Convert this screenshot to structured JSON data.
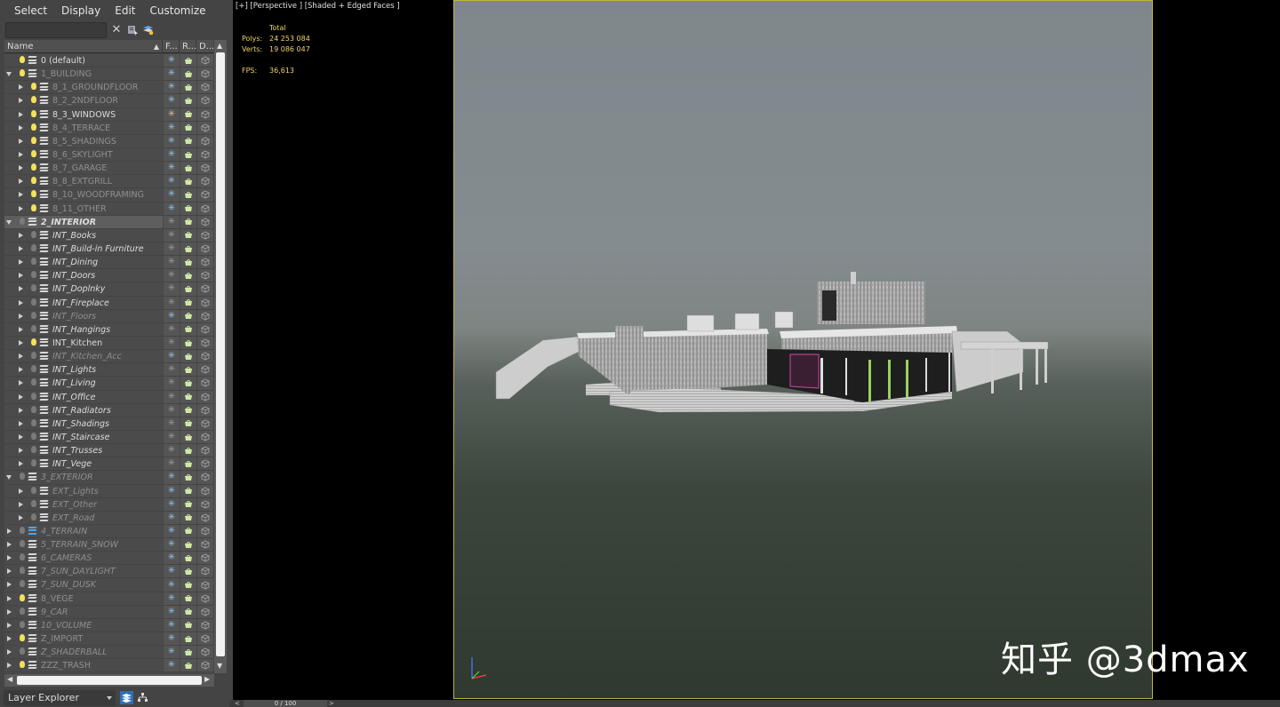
{
  "menu": [
    "Select",
    "Display",
    "Edit",
    "Customize"
  ],
  "columns": {
    "name": "Name",
    "freeze": "F...",
    "render": "R...",
    "display": "D..."
  },
  "layers": [
    {
      "name": "0 (default)",
      "indent": 0,
      "arrow": "none",
      "bulb": "on",
      "style": "normal",
      "freeze": "normal"
    },
    {
      "name": "1_BUILDING",
      "indent": 0,
      "arrow": "down",
      "bulb": "on",
      "style": "dim",
      "freeze": "normal"
    },
    {
      "name": "8_1_GROUNDFLOOR",
      "indent": 1,
      "arrow": "right",
      "bulb": "on",
      "style": "dim",
      "freeze": "normal"
    },
    {
      "name": "8_2_2NDFLOOR",
      "indent": 1,
      "arrow": "right",
      "bulb": "on",
      "style": "dim",
      "freeze": "normal"
    },
    {
      "name": "8_3_WINDOWS",
      "indent": 1,
      "arrow": "right",
      "bulb": "on",
      "style": "normal",
      "freeze": "hot"
    },
    {
      "name": "8_4_TERRACE",
      "indent": 1,
      "arrow": "right",
      "bulb": "on",
      "style": "dim",
      "freeze": "normal"
    },
    {
      "name": "8_5_SHADINGS",
      "indent": 1,
      "arrow": "right",
      "bulb": "on",
      "style": "dim",
      "freeze": "normal"
    },
    {
      "name": "8_6_SKYLIGHT",
      "indent": 1,
      "arrow": "right",
      "bulb": "on",
      "style": "dim",
      "freeze": "normal"
    },
    {
      "name": "8_7_GARAGE",
      "indent": 1,
      "arrow": "right",
      "bulb": "on",
      "style": "dim",
      "freeze": "normal"
    },
    {
      "name": "8_8_EXTGRILL",
      "indent": 1,
      "arrow": "right",
      "bulb": "on",
      "style": "dim",
      "freeze": "normal"
    },
    {
      "name": "8_10_WOODFRAMING",
      "indent": 1,
      "arrow": "right",
      "bulb": "on",
      "style": "dim",
      "freeze": "normal"
    },
    {
      "name": "8_11_OTHER",
      "indent": 1,
      "arrow": "right",
      "bulb": "on",
      "style": "dim",
      "freeze": "normal"
    },
    {
      "name": "2_INTERIOR",
      "indent": 0,
      "arrow": "down",
      "bulb": "off",
      "style": "bold-it",
      "freeze": "dim",
      "selected": true
    },
    {
      "name": "INT_Books",
      "indent": 1,
      "arrow": "right",
      "bulb": "off",
      "style": "it",
      "freeze": "dim"
    },
    {
      "name": "INT_Build-in Furniture",
      "indent": 1,
      "arrow": "right",
      "bulb": "off",
      "style": "it",
      "freeze": "dim"
    },
    {
      "name": "INT_Dining",
      "indent": 1,
      "arrow": "right",
      "bulb": "off",
      "style": "it",
      "freeze": "dim"
    },
    {
      "name": "INT_Doors",
      "indent": 1,
      "arrow": "right",
      "bulb": "off",
      "style": "it",
      "freeze": "dim"
    },
    {
      "name": "INT_Doplnky",
      "indent": 1,
      "arrow": "right",
      "bulb": "off",
      "style": "it",
      "freeze": "dim"
    },
    {
      "name": "INT_Fireplace",
      "indent": 1,
      "arrow": "right",
      "bulb": "off",
      "style": "it",
      "freeze": "dim"
    },
    {
      "name": "INT_Floors",
      "indent": 1,
      "arrow": "right",
      "bulb": "off",
      "style": "dim-it",
      "freeze": "normal"
    },
    {
      "name": "INT_Hangings",
      "indent": 1,
      "arrow": "right",
      "bulb": "off",
      "style": "it",
      "freeze": "dim"
    },
    {
      "name": "INT_Kitchen",
      "indent": 1,
      "arrow": "right",
      "bulb": "on",
      "style": "normal",
      "freeze": "dim"
    },
    {
      "name": "INT_Kitchen_Acc",
      "indent": 1,
      "arrow": "right",
      "bulb": "off",
      "style": "dim-it",
      "freeze": "normal"
    },
    {
      "name": "INT_Lights",
      "indent": 1,
      "arrow": "right",
      "bulb": "off",
      "style": "it",
      "freeze": "dim"
    },
    {
      "name": "INT_Living",
      "indent": 1,
      "arrow": "right",
      "bulb": "off",
      "style": "it",
      "freeze": "dim"
    },
    {
      "name": "INT_Office",
      "indent": 1,
      "arrow": "right",
      "bulb": "off",
      "style": "it",
      "freeze": "dim"
    },
    {
      "name": "INT_Radiators",
      "indent": 1,
      "arrow": "right",
      "bulb": "off",
      "style": "it",
      "freeze": "dim"
    },
    {
      "name": "INT_Shadings",
      "indent": 1,
      "arrow": "right",
      "bulb": "off",
      "style": "it",
      "freeze": "dim"
    },
    {
      "name": "INT_Staircase",
      "indent": 1,
      "arrow": "right",
      "bulb": "off",
      "style": "it",
      "freeze": "dim"
    },
    {
      "name": "INT_Trusses",
      "indent": 1,
      "arrow": "right",
      "bulb": "off",
      "style": "it",
      "freeze": "dim"
    },
    {
      "name": "INT_Vege",
      "indent": 1,
      "arrow": "right",
      "bulb": "off",
      "style": "it",
      "freeze": "dim"
    },
    {
      "name": "3_EXTERIOR",
      "indent": 0,
      "arrow": "down",
      "bulb": "off",
      "style": "dim-it",
      "freeze": "normal"
    },
    {
      "name": "EXT_Lights",
      "indent": 1,
      "arrow": "right",
      "bulb": "off",
      "style": "dim-it",
      "freeze": "normal"
    },
    {
      "name": "EXT_Other",
      "indent": 1,
      "arrow": "right",
      "bulb": "off",
      "style": "dim-it",
      "freeze": "normal"
    },
    {
      "name": "EXT_Road",
      "indent": 1,
      "arrow": "right",
      "bulb": "off",
      "style": "dim-it",
      "freeze": "normal"
    },
    {
      "name": "4_TERRAIN",
      "indent": 0,
      "arrow": "right",
      "bulb": "off",
      "style": "dim-it",
      "freeze": "normal",
      "blue": true
    },
    {
      "name": "5_TERRAIN_SNOW",
      "indent": 0,
      "arrow": "right",
      "bulb": "off",
      "style": "dim-it",
      "freeze": "normal"
    },
    {
      "name": "6_CAMERAS",
      "indent": 0,
      "arrow": "right",
      "bulb": "off",
      "style": "dim-it",
      "freeze": "normal"
    },
    {
      "name": "7_SUN_DAYLIGHT",
      "indent": 0,
      "arrow": "right",
      "bulb": "off",
      "style": "dim-it",
      "freeze": "normal"
    },
    {
      "name": "7_SUN_DUSK",
      "indent": 0,
      "arrow": "right",
      "bulb": "off",
      "style": "dim-it",
      "freeze": "normal"
    },
    {
      "name": "8_VEGE",
      "indent": 0,
      "arrow": "right",
      "bulb": "on",
      "style": "dim",
      "freeze": "normal"
    },
    {
      "name": "9_CAR",
      "indent": 0,
      "arrow": "right",
      "bulb": "off",
      "style": "dim-it",
      "freeze": "normal"
    },
    {
      "name": "10_VOLUME",
      "indent": 0,
      "arrow": "right",
      "bulb": "off",
      "style": "dim-it",
      "freeze": "normal"
    },
    {
      "name": "Z_IMPORT",
      "indent": 0,
      "arrow": "right",
      "bulb": "on",
      "style": "dim",
      "freeze": "normal"
    },
    {
      "name": "Z_SHADERBALL",
      "indent": 0,
      "arrow": "right",
      "bulb": "off",
      "style": "dim-it",
      "freeze": "normal"
    },
    {
      "name": "ZZZ_TRASH",
      "indent": 0,
      "arrow": "right",
      "bulb": "on",
      "style": "dim",
      "freeze": "normal"
    }
  ],
  "explorer": {
    "label": "Layer Explorer"
  },
  "viewport": {
    "label": "[+] [Perspective ] [Shaded + Edged Faces ]",
    "stats_header": "Total",
    "polys_label": "Polys:",
    "polys": "24 253 084",
    "verts_label": "Verts:",
    "verts": "19 086 047",
    "fps_label": "FPS:",
    "fps": "36,613"
  },
  "watermark": "知乎 @3dmax",
  "timeline": {
    "frame": "0 / 100"
  },
  "colors": {
    "frame_border": "#c2b338",
    "stats": "#f2d36b",
    "bulb_on": "#f2e15a",
    "freeze": "#8fc6ec"
  }
}
